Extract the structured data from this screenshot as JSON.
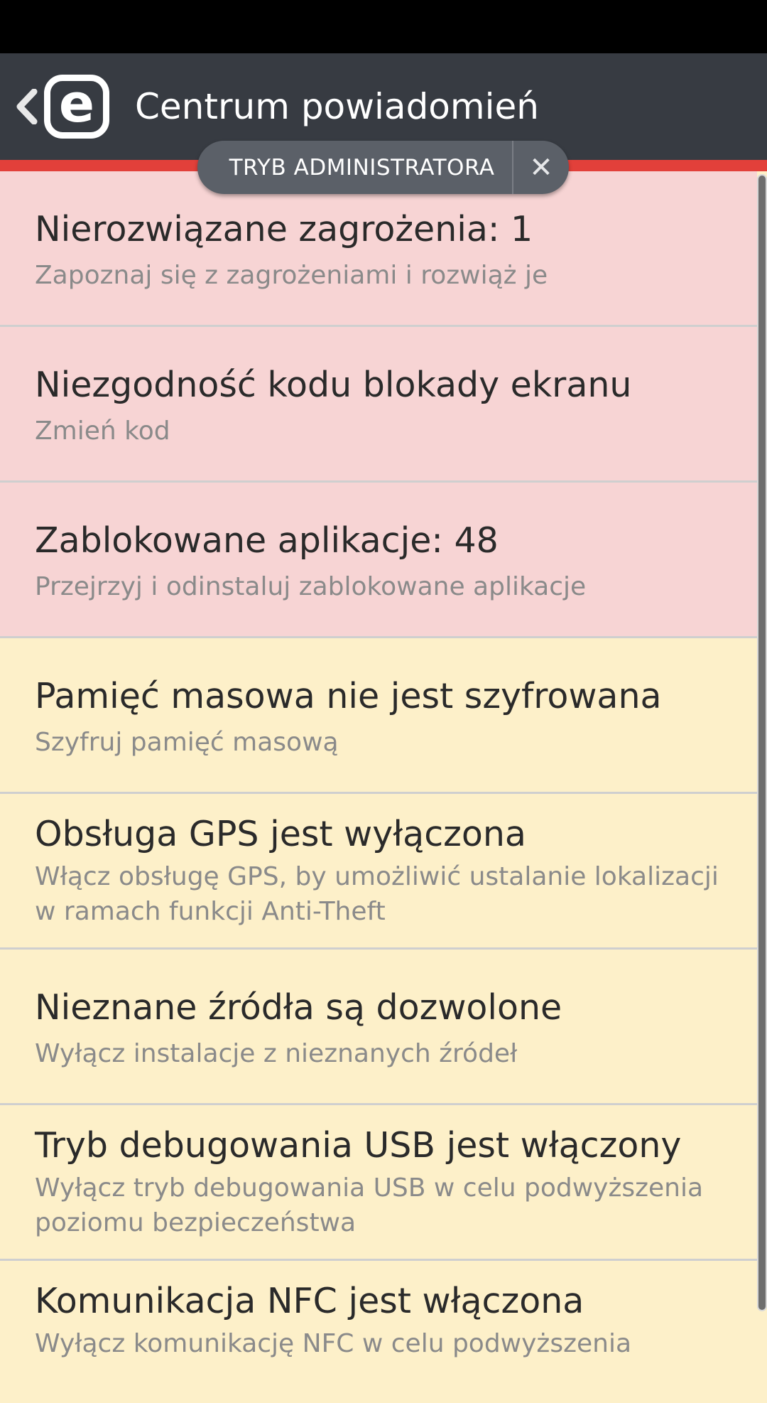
{
  "header": {
    "title": "Centrum powiadomień",
    "logo_letter": "e"
  },
  "admin_mode": {
    "label": "TRYB ADMINISTRATORA",
    "close_glyph": "✕"
  },
  "colors": {
    "app_bar": "#373b42",
    "accent_red": "#e2403a",
    "critical_bg": "#f7d4d4",
    "warning_bg": "#fdf0c9"
  },
  "notifications": [
    {
      "title": "Nierozwiązane zagrożenia: 1",
      "subtitle": "Zapoznaj się z zagrożeniami i rozwiąż je",
      "severity": "critical"
    },
    {
      "title": "Niezgodność kodu blokady ekranu",
      "subtitle": "Zmień kod",
      "severity": "critical"
    },
    {
      "title": "Zablokowane aplikacje: 48",
      "subtitle": "Przejrzyj i odinstaluj zablokowane aplikacje",
      "severity": "critical"
    },
    {
      "title": "Pamięć masowa nie jest szyfrowana",
      "subtitle": "Szyfruj pamięć masową",
      "severity": "warning"
    },
    {
      "title": "Obsługa GPS jest wyłączona",
      "subtitle": "Włącz obsługę GPS, by umożliwić ustalanie lokalizacji w ramach funkcji Anti-Theft",
      "severity": "warning"
    },
    {
      "title": "Nieznane źródła są dozwolone",
      "subtitle": "Wyłącz instalacje z nieznanych źródeł",
      "severity": "warning"
    },
    {
      "title": "Tryb debugowania USB jest włączony",
      "subtitle": "Wyłącz tryb debugowania USB w celu podwyższenia poziomu bezpieczeństwa",
      "severity": "warning"
    },
    {
      "title": "Komunikacja NFC jest włączona",
      "subtitle": "Wyłącz komunikację NFC w celu podwyższenia",
      "severity": "warning"
    }
  ]
}
